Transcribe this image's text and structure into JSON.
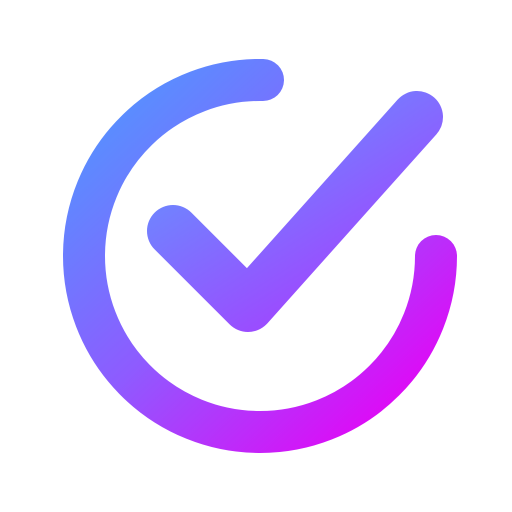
{
  "app_icon": {
    "icon": "check-circle-icon",
    "background_color": "#FFFFFF",
    "gradient": {
      "start_color": "#5B8CFF",
      "mid_color": "#8E5BFF",
      "end_color": "#E800F5"
    }
  }
}
